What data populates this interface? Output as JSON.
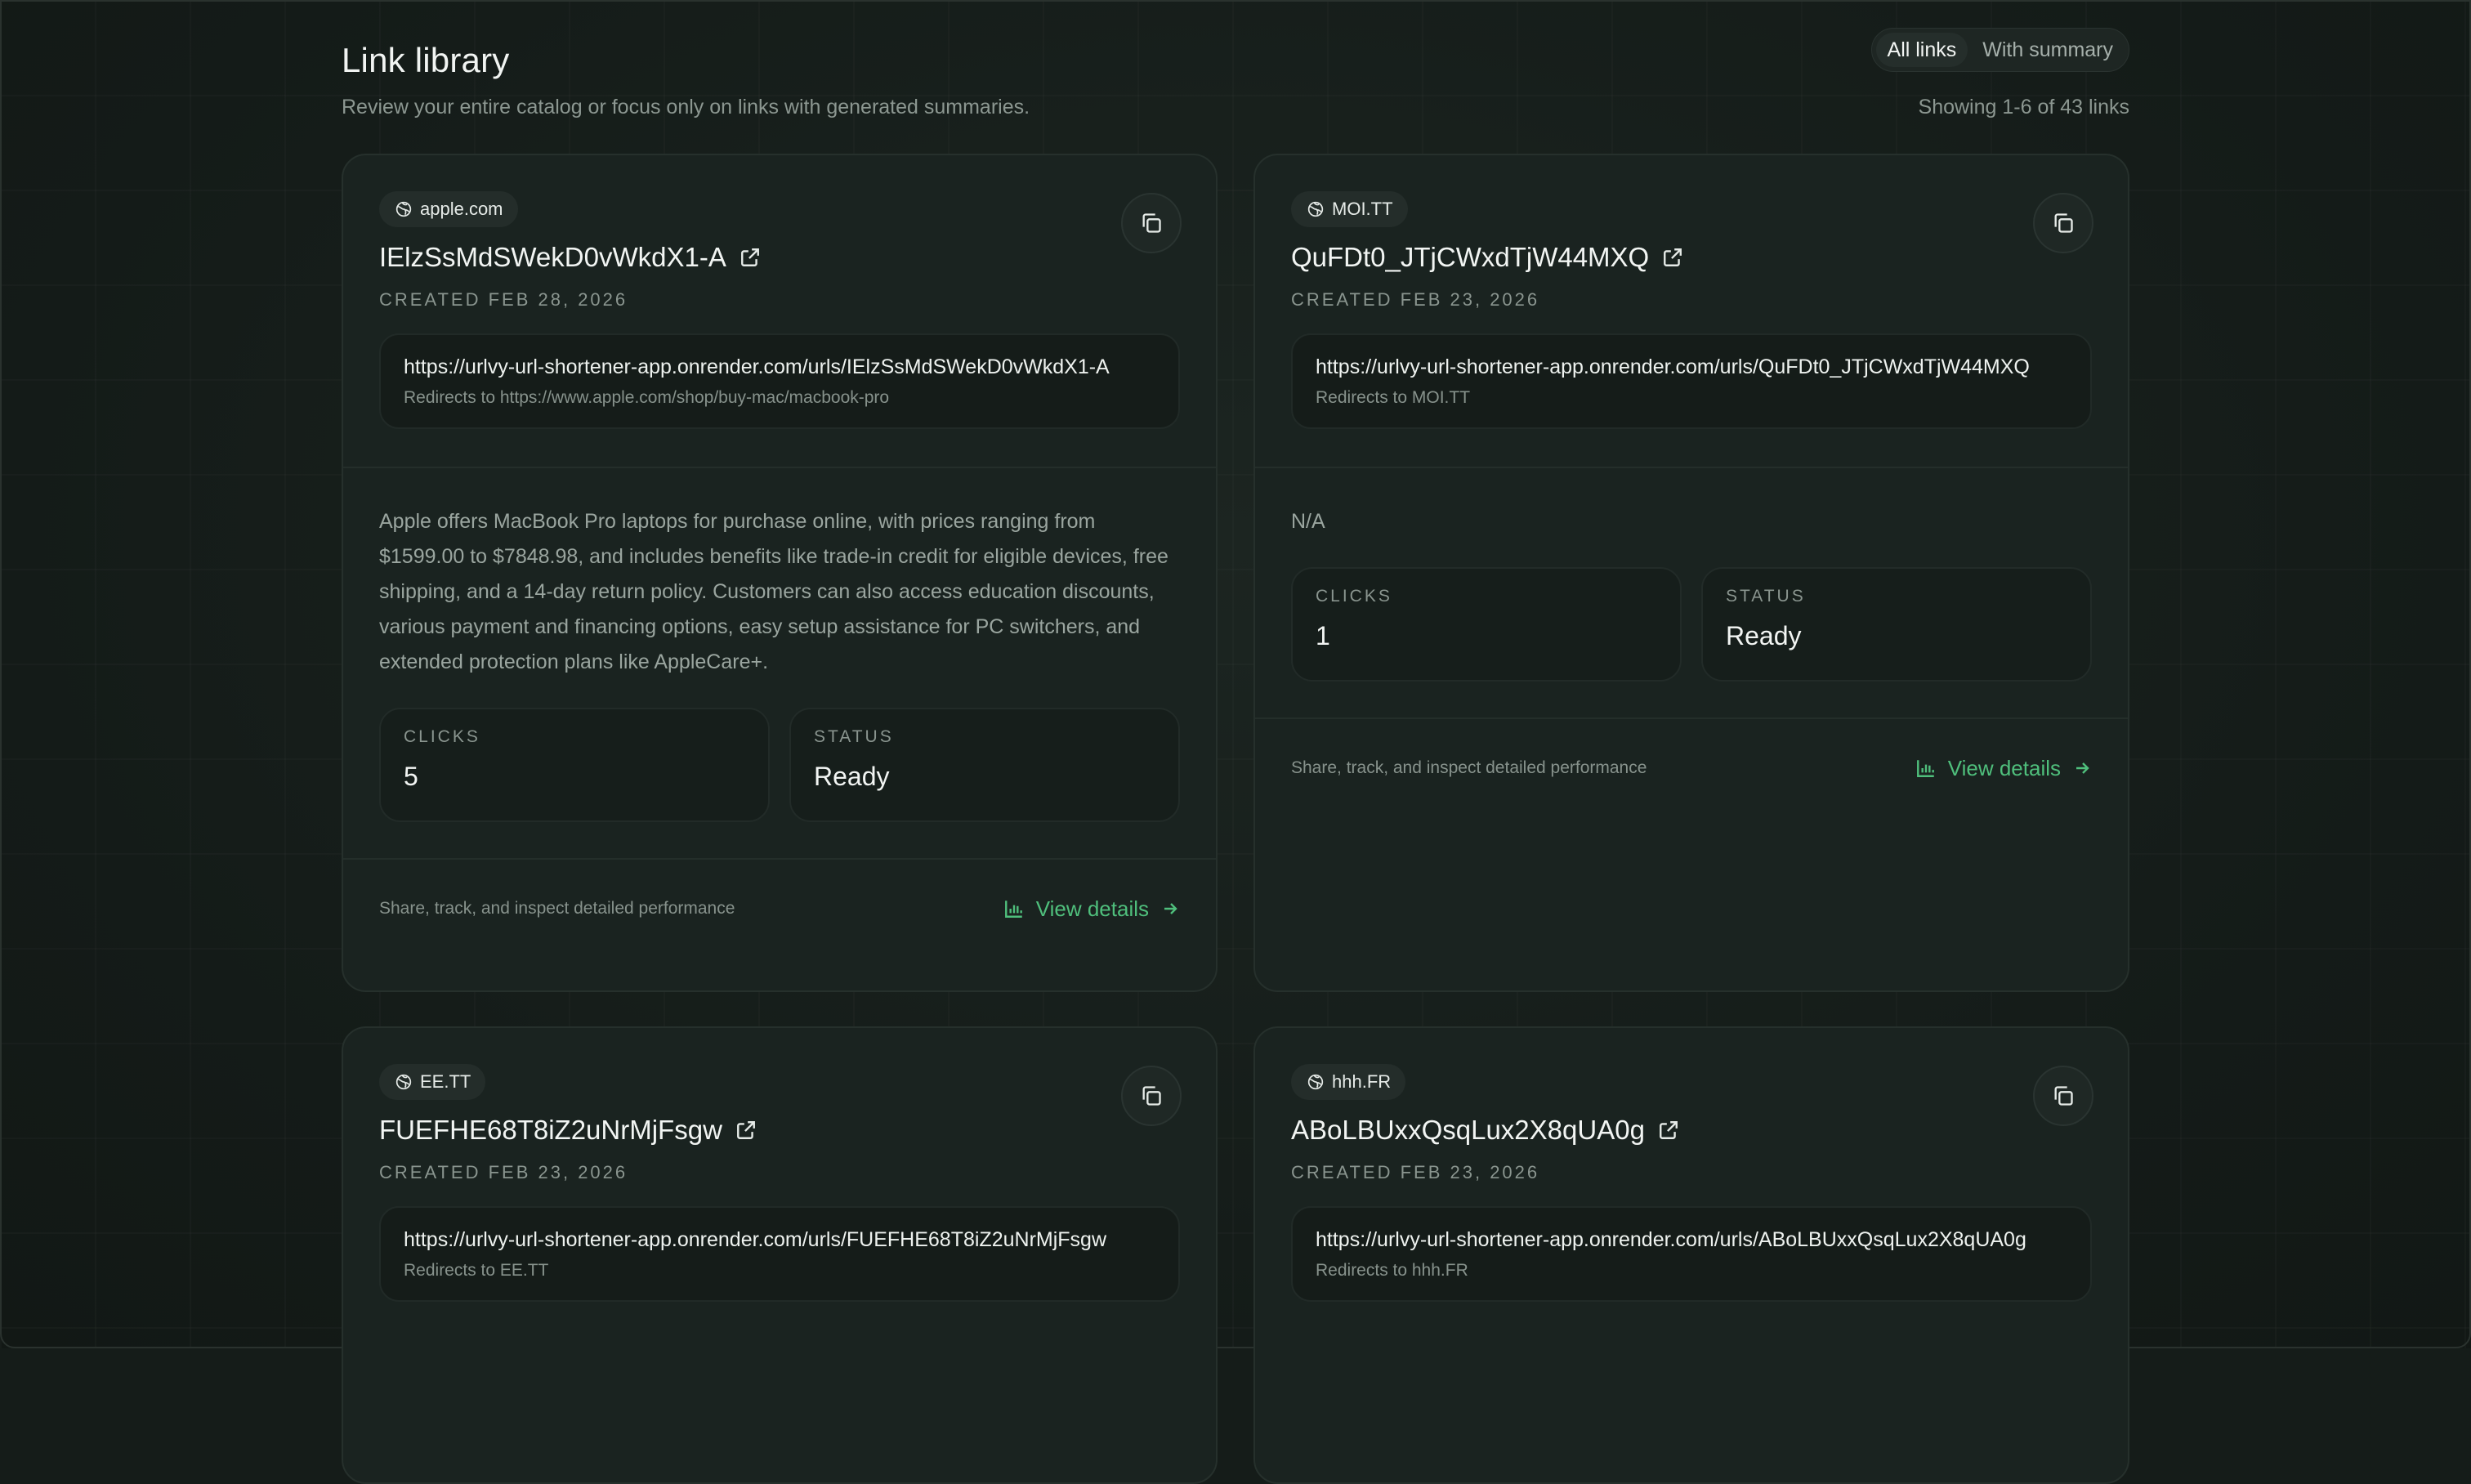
{
  "header": {
    "title": "Link library",
    "subtitle": "Review your entire catalog or focus only on links with generated summaries.",
    "filters": [
      "All links",
      "With summary"
    ],
    "active_filter": "All links",
    "showing": "Showing 1-6 of 43 links"
  },
  "labels": {
    "clicks": "CLICKS",
    "status": "STATUS",
    "footer": "Share, track, and inspect detailed performance",
    "view_details": "View details"
  },
  "cards": [
    {
      "domain": "apple.com",
      "code": "IElzSsMdSWekD0vWkdX1-A",
      "created": "CREATED FEB 28, 2026",
      "short_url": "https://urlvy-url-shortener-app.onrender.com/urls/IElzSsMdSWekD0vWkdX1-A",
      "redirect": "Redirects to https://www.apple.com/shop/buy-mac/macbook-pro",
      "summary": "Apple offers MacBook Pro laptops for purchase online, with prices ranging from $1599.00 to $7848.98, and includes benefits like trade-in credit for eligible devices, free shipping, and a 14-day return policy. Customers can also access education discounts, various payment and financing options, easy setup assistance for PC switchers, and extended protection plans like AppleCare+.",
      "clicks": "5",
      "status": "Ready"
    },
    {
      "domain": "MOI.TT",
      "code": "QuFDt0_JTjCWxdTjW44MXQ",
      "created": "CREATED FEB 23, 2026",
      "short_url": "https://urlvy-url-shortener-app.onrender.com/urls/QuFDt0_JTjCWxdTjW44MXQ",
      "redirect": "Redirects to MOI.TT",
      "summary": "N/A",
      "clicks": "1",
      "status": "Ready"
    },
    {
      "domain": "EE.TT",
      "code": "FUEFHE68T8iZ2uNrMjFsgw",
      "created": "CREATED FEB 23, 2026",
      "short_url": "https://urlvy-url-shortener-app.onrender.com/urls/FUEFHE68T8iZ2uNrMjFsgw",
      "redirect": "Redirects to EE.TT"
    },
    {
      "domain": "hhh.FR",
      "code": "ABoLBUxxQsqLux2X8qUA0g",
      "created": "CREATED FEB 23, 2026",
      "short_url": "https://urlvy-url-shortener-app.onrender.com/urls/ABoLBUxxQsqLux2X8qUA0g",
      "redirect": "Redirects to hhh.FR"
    }
  ],
  "colors": {
    "accent": "#4fbf7c",
    "background": "#151c19",
    "card": "#1a2320"
  }
}
